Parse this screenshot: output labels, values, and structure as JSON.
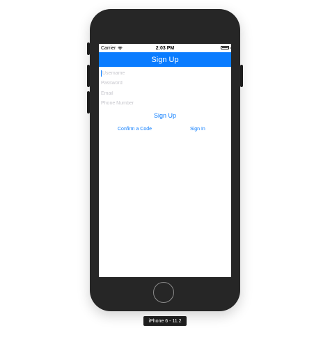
{
  "status_bar": {
    "carrier": "Carrier",
    "time": "2:03 PM"
  },
  "nav": {
    "title": "Sign Up"
  },
  "form": {
    "username_placeholder": "Username",
    "password_placeholder": "Password",
    "email_placeholder": "Email",
    "phone_placeholder": "Phone Number",
    "signup_label": "Sign Up"
  },
  "links": {
    "confirm_label": "Confirm a Code",
    "signin_label": "Sign In"
  },
  "device": {
    "label": "iPhone 6 - 11.2"
  },
  "colors": {
    "accent": "#0a7cff",
    "device_body": "#262626"
  }
}
